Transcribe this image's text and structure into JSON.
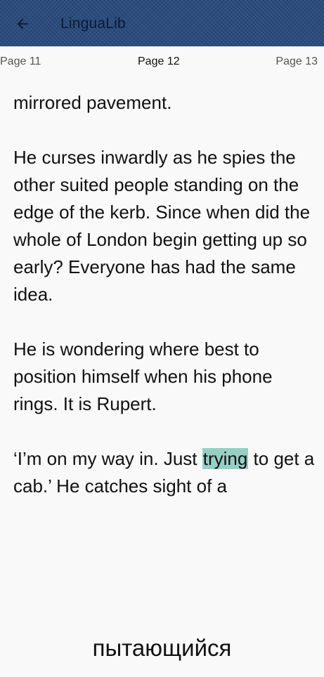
{
  "header": {
    "back_icon": "arrow-left-icon",
    "title": "LinguaLib",
    "bar_color": "#27497b"
  },
  "pager": {
    "prev": "Page 11",
    "current": "Page 12",
    "next": "Page 13"
  },
  "reader": {
    "p1": "mirrored pavement.",
    "p2": "He curses inwardly as he spies the other suited people standing on the edge of the kerb. Since when did the whole of London begin getting up so early? Everyone has had the same idea.",
    "p3": "He is wondering where best to position himself when his phone rings. It is Rupert.",
    "p4_before": "‘I’m on my way in. Just ",
    "p4_word": "trying",
    "p4_after": " to get a cab.’ He catches sight of a",
    "highlight_color": "#96cfc6"
  },
  "translation": {
    "text": "пытающийся"
  }
}
